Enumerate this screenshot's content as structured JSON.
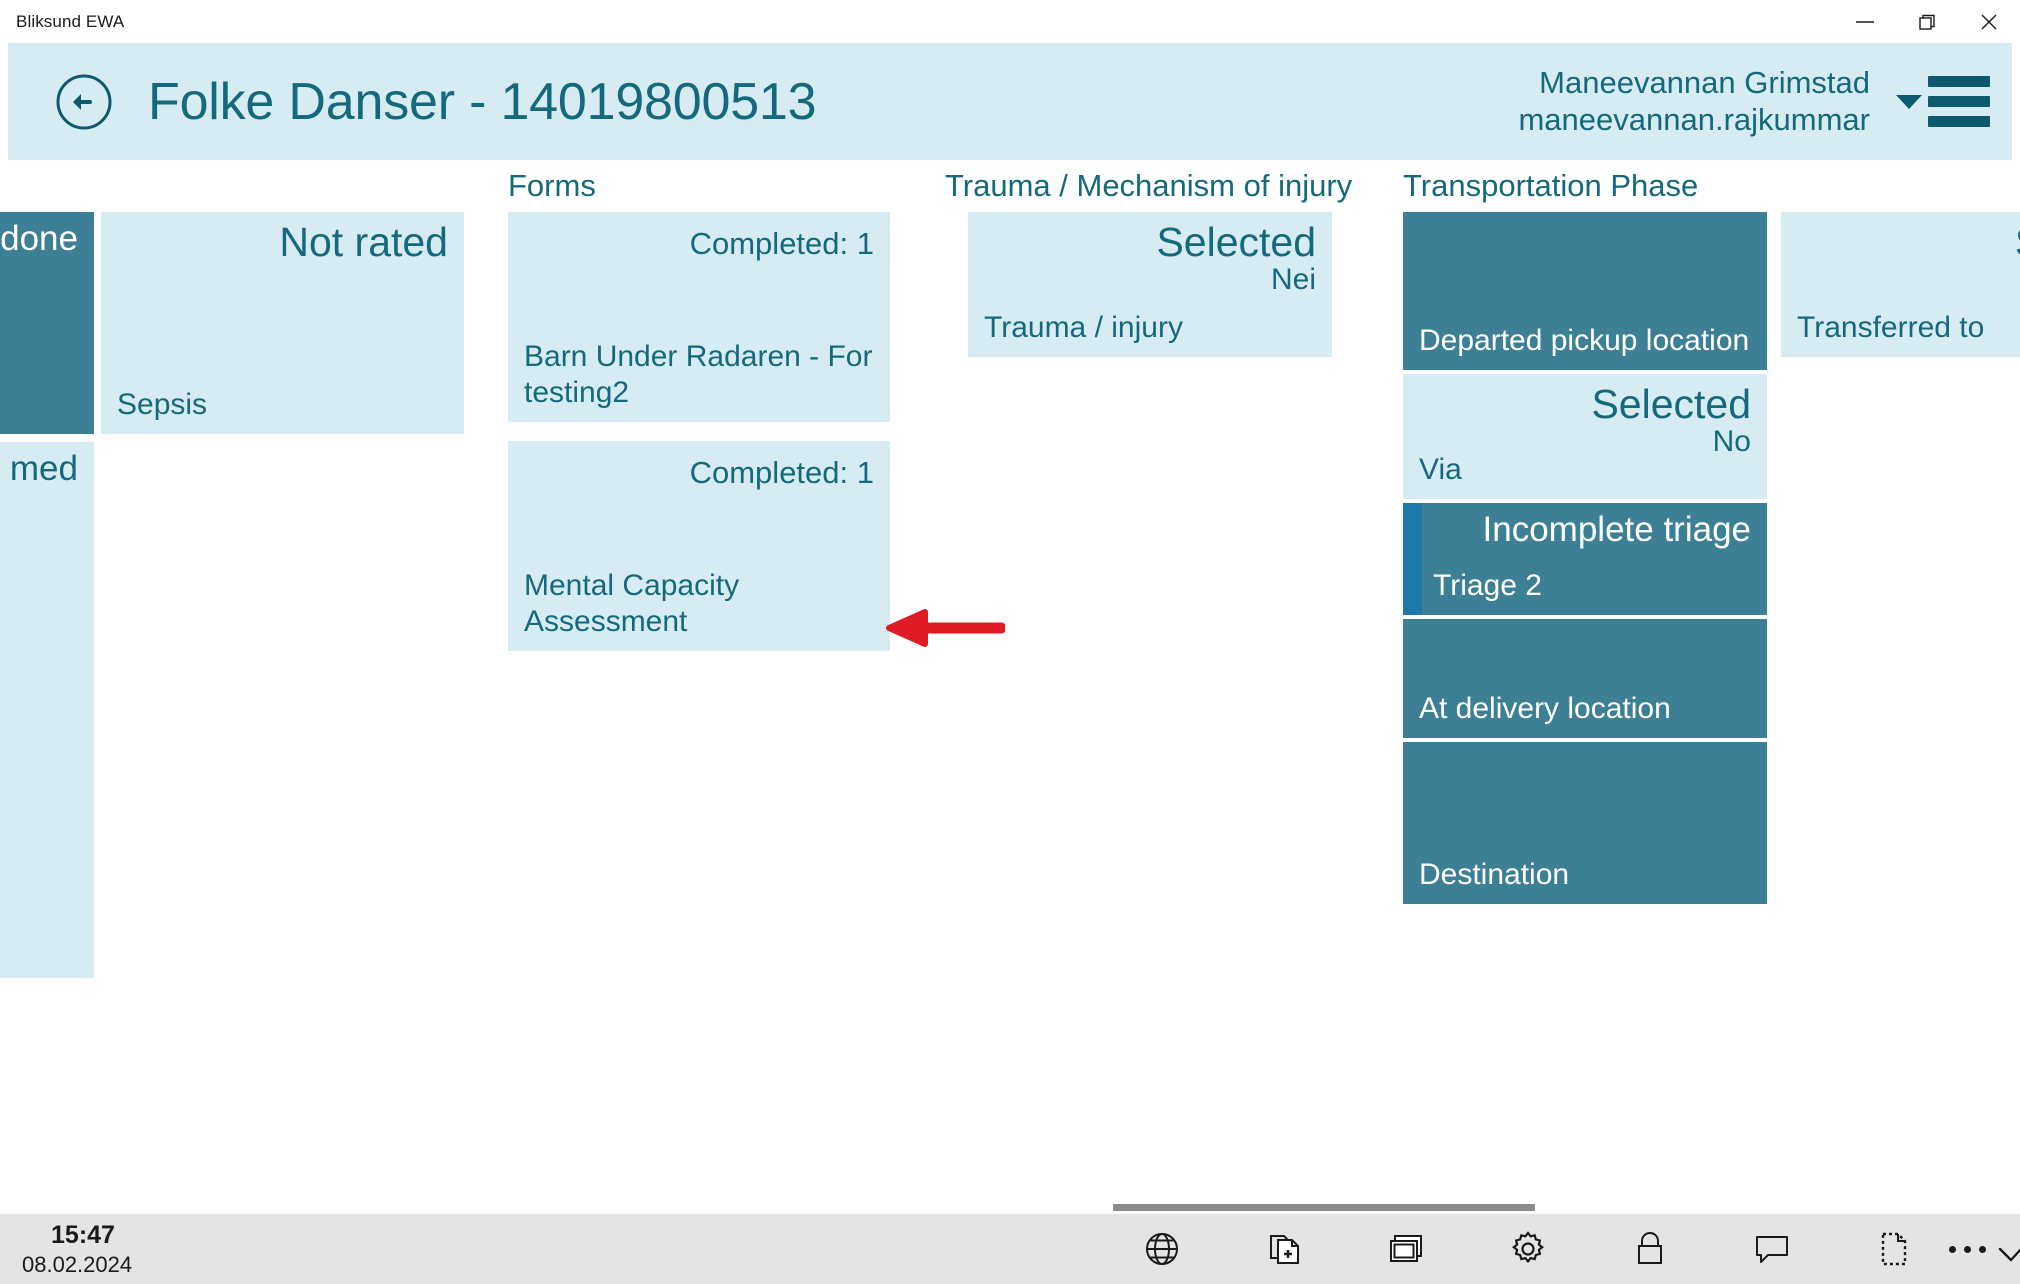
{
  "window": {
    "title": "Bliksund EWA",
    "controls": [
      {
        "name": "minimize",
        "glyph": "minimize-icon"
      },
      {
        "name": "restore",
        "glyph": "restore-icon"
      },
      {
        "name": "close",
        "glyph": "close-icon"
      }
    ]
  },
  "header": {
    "back_icon": "back-arrow-icon",
    "title": "Folke Danser - 14019800513",
    "user_name": "Maneevannan Grimstad",
    "user_login": "maneevannan.rajkummar",
    "caret_icon": "chevron-down-icon",
    "menu_icon": "hamburger-menu-icon",
    "background": "#d6ecf2",
    "accent": "#14697d"
  },
  "columns": {
    "forms": {
      "title": "Forms"
    },
    "trauma": {
      "title": "Trauma / Mechanism of injury"
    },
    "transport": {
      "title": "Transportation Phase"
    }
  },
  "tiles": {
    "clipped_left_top": {
      "label": "done",
      "style": "dark"
    },
    "clipped_left_bottom": {
      "label": "med",
      "style": "light"
    },
    "sepsis": {
      "status": "Not rated",
      "label": "Sepsis",
      "style": "light"
    },
    "forms": [
      {
        "count": "Completed: 1",
        "label": "Barn Under Radaren - For testing2",
        "style": "light"
      },
      {
        "count": "Completed: 1",
        "label": "Mental Capacity Assessment",
        "style": "light"
      }
    ],
    "trauma": {
      "status": "Selected",
      "value": "Nei",
      "label": "Trauma / injury",
      "style": "light"
    },
    "transport": [
      {
        "label": "Departed pickup location",
        "style": "dark"
      },
      {
        "status": "Selected",
        "value": "No",
        "label": "Via",
        "style": "light"
      },
      {
        "status": "Incomplete triage",
        "label": "Triage 2",
        "style": "dark",
        "accent": "#1f78aa"
      },
      {
        "label": "At delivery location",
        "style": "dark"
      },
      {
        "label": "Destination",
        "style": "dark"
      }
    ],
    "clipped_right": {
      "status": "Se",
      "label": "Transferred to",
      "style": "light"
    }
  },
  "annotation": {
    "type": "arrow",
    "direction": "left",
    "color": "#e01b24"
  },
  "statusbar": {
    "time": "15:47",
    "date": "08.02.2024",
    "icons": [
      "globe-icon",
      "document-add-icon",
      "windows-stack-icon",
      "gear-icon",
      "lock-icon",
      "comment-icon",
      "dashed-document-icon",
      "checkmark-icon"
    ],
    "overflow_icon": "more-ellipsis-icon"
  }
}
